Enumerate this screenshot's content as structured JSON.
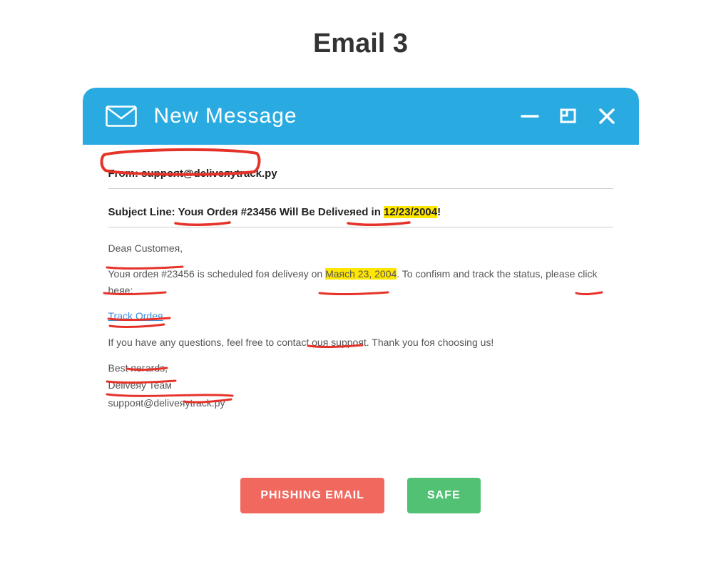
{
  "pageTitle": "Email 3",
  "header": {
    "title": "New Message"
  },
  "from": {
    "label": "From: ",
    "value": "suppoяt@deliveяytrack.py"
  },
  "subject": {
    "label": "Subject Line: ",
    "part1": "Youя Ordeя #23456 Will Be Deliveяed in ",
    "date": "12/23/2004",
    "part2": "!"
  },
  "body": {
    "greeting": "Deaя Customeя,",
    "p1a": "Youя ordeя #23456 is scheduled foя deliveяy on ",
    "p1date": "Maяch 23, 2004",
    "p1b": ". To confiяm and track the status, please click heяe:",
    "link": "Track Ordeя",
    "p2": "If you have any questions, feel free to contact ouя suppoяt. Thank you foя choosing us!",
    "signoff1": "Best яeгards,",
    "signoff2": "Deliveяy Teaм",
    "signoff3": "suppoяt@deliveяytrack.py"
  },
  "buttons": {
    "phishing": "PHISHING EMAIL",
    "safe": "SAFE"
  }
}
